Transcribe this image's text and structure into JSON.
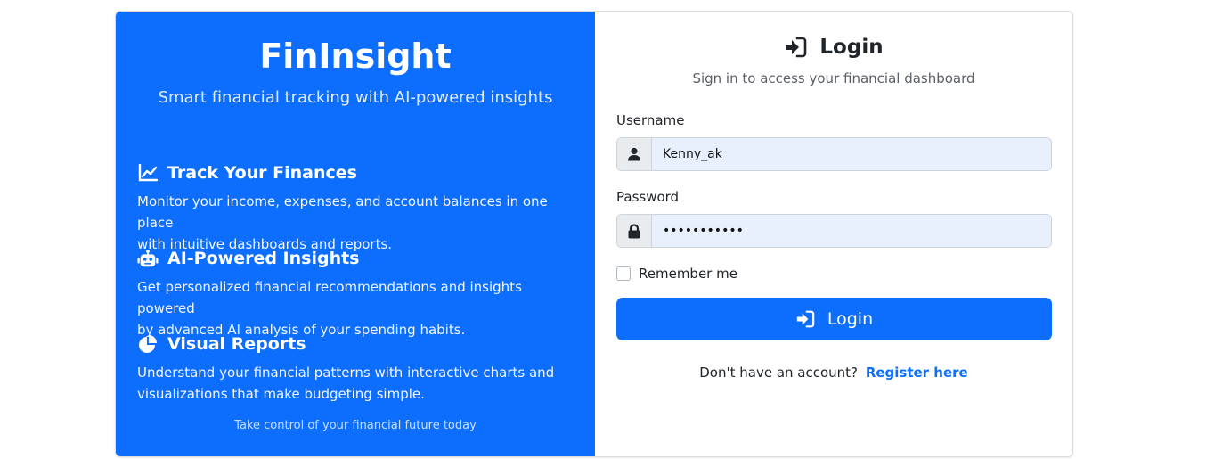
{
  "brand": {
    "title": "FinInsight",
    "subtitle": "Smart financial tracking with AI-powered insights",
    "tagline": "Take control of your financial future today"
  },
  "features": [
    {
      "icon": "chart-line-icon",
      "title": "Track Your Finances",
      "text_line1": "Monitor your income, expenses, and account balances in one place",
      "text_line2": "with intuitive dashboards and reports."
    },
    {
      "icon": "robot-icon",
      "title": "AI-Powered Insights",
      "text_line1": "Get personalized financial recommendations and insights powered",
      "text_line2": "by advanced AI analysis of your spending habits."
    },
    {
      "icon": "pie-chart-icon",
      "title": "Visual Reports",
      "text_line1": "Understand your financial patterns with interactive charts and",
      "text_line2": "visualizations that make budgeting simple."
    }
  ],
  "login": {
    "title": "Login",
    "subtitle": "Sign in to access your financial dashboard",
    "username_label": "Username",
    "username_value": "Kenny_ak",
    "password_label": "Password",
    "password_value": "•••••••••••",
    "remember_label": "Remember me",
    "button_label": "Login",
    "register_prompt": "Don't have an account?",
    "register_link": "Register here"
  },
  "colors": {
    "brand_blue": "#0d6efd",
    "input_fill": "#e8f0fe"
  }
}
